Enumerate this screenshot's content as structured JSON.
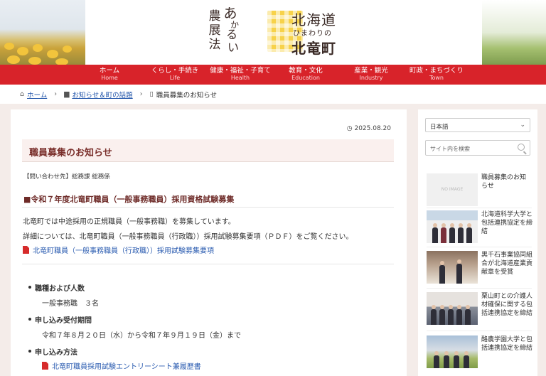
{
  "header": {
    "logo_vertical": [
      "農",
      "展",
      "法",
      "あ",
      "か",
      "る",
      "い"
    ],
    "logo_vert_text_1": "農展法",
    "logo_vert_text_2": "あかるい",
    "logo_title_1": "北海道",
    "logo_title_2": "ひまわりの",
    "logo_title_3": "北竜町"
  },
  "nav": [
    {
      "label": "ホーム",
      "sub": "Home"
    },
    {
      "label": "くらし・手続き",
      "sub": "Life"
    },
    {
      "label": "健康・福祉・子育て",
      "sub": "Health"
    },
    {
      "label": "教育・文化",
      "sub": "Education"
    },
    {
      "label": "産業・観光",
      "sub": "Industry"
    },
    {
      "label": "町政・まちづくり",
      "sub": "Town"
    }
  ],
  "breadcrumb": {
    "home": "ホーム",
    "category": "お知らせ＆町の話題",
    "current": "職員募集のお知らせ"
  },
  "article": {
    "date": "2025.08.20",
    "title": "職員募集のお知らせ",
    "contact": "【問い合わせ先】総務課 総務係",
    "section_heading": "■令和７年度北竜町職員（一般事務職員）採用資格試験募集",
    "para1": "北竜町では中途採用の正規職員（一般事務職）を募集しています。",
    "para2": "詳細については、北竜町職員（一般事務職員（行政職））採用試験募集要項（ＰＤＦ）をご覧ください。",
    "pdf_link": "北竜町職員（一般事務職員（行政職））採用試験募集要項",
    "items": [
      {
        "label": "職種および人数",
        "value": "一般事務職　３名"
      },
      {
        "label": "申し込み受付期間",
        "value": "令和７年８月２０日（水）から令和７年９月１９日（金）まで"
      },
      {
        "label": "申し込み方法",
        "value": ""
      }
    ],
    "entry_link": "北竜町職員採用試験エントリーシート兼履歴書"
  },
  "sidebar": {
    "language": "日本語",
    "search_placeholder": "サイト内を検索",
    "noimage_text": "NO IMAGE",
    "posts": [
      {
        "title": "職員募集のお知らせ"
      },
      {
        "title": "北海道科学大学と包括連携協定を締結"
      },
      {
        "title": "黒千石事業協同組合が北海道産業貢献章を受賞"
      },
      {
        "title": "栗山町との介護人材確保に関する包括連携協定を締結"
      },
      {
        "title": "酪農学園大学と包括連携協定を締結"
      }
    ]
  },
  "colors": {
    "nav_red": "#d8232a",
    "title_brown": "#7a2f2b",
    "link_blue": "#2a5bb0",
    "page_bg": "#f4ece9"
  }
}
